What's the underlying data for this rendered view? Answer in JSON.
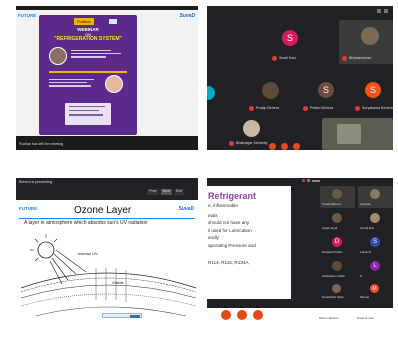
{
  "q1": {
    "logo_left": "FUTURE",
    "logo_right": "SuveD",
    "badge": "RuiBlue",
    "webinar_line1": "WEBINAR",
    "webinar_line2": "ON",
    "webinar_title": "\"REFRIGERATION SYSTEM\"",
    "status_text": "Rudhar has left the meeting"
  },
  "q2": {
    "names": [
      "Swati Kaur",
      "Kusumalata Behera",
      "Bhubaneswar",
      "Pradip Behera",
      "Pritam Behera",
      "Suryakanta Behera",
      "Smruti",
      "Bhatnagar Mohanty"
    ],
    "initials": [
      "S",
      "S",
      "S"
    ]
  },
  "q3": {
    "presenting": "Behera is presenting",
    "header_buttons": [
      "Prev",
      "Next",
      "Exit"
    ],
    "logo_left": "FUTURE",
    "logo_right": "SuveD",
    "slide_title": "Ozone Layer",
    "body": "A layer in atmosphere which absorbs sun's UV radiation",
    "label_sun": "Intense UV",
    "label_visible": "Visible"
  },
  "q4": {
    "slide_title": "Refrigerant",
    "lines": [
      "e, inflammable",
      "etals",
      "should not have any",
      "il used for Lubrication",
      "endly",
      "aporating Pressure and",
      "R114, R115, R134A,"
    ],
    "participant_names": [
      "Pradip Behera",
      "Anupam",
      "Anjali Joyal",
      "Sonali Rai",
      "Debasish Dash",
      "Lakshmi",
      "Subhalaxmi Rath",
      "S",
      "Debashish Sahu",
      "Manas"
    ],
    "letters": [
      "D",
      "S",
      "L",
      "M"
    ],
    "bottom_labels": [
      "Show captions",
      "Present now"
    ]
  }
}
